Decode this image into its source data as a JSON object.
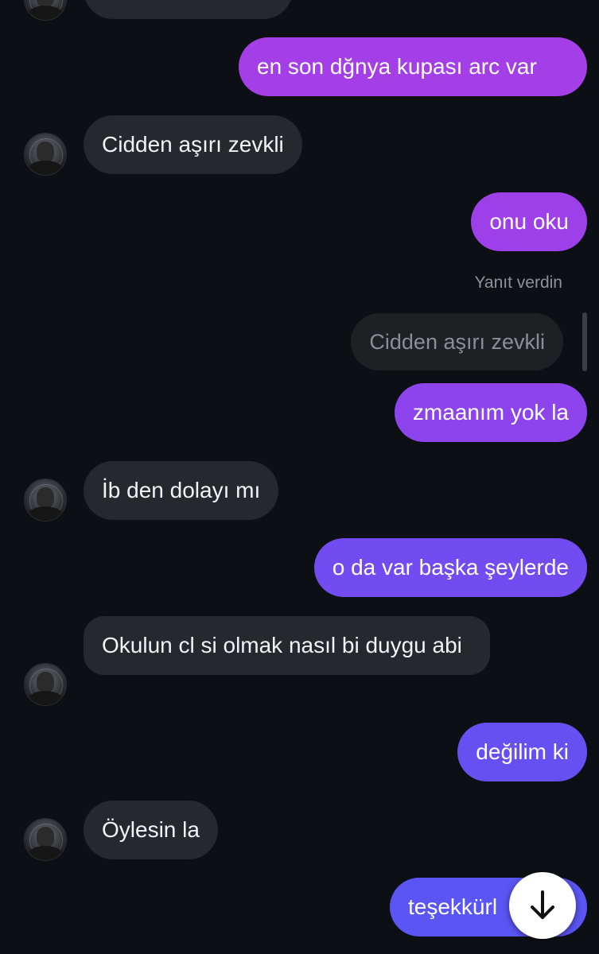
{
  "colors": {
    "background": "#0c1014",
    "incoming_bubble": "#25282d",
    "outgoing_gradient_top": "#a13fe8",
    "outgoing_gradient_bottom": "#5b55f2"
  },
  "messages": [
    {
      "dir": "in",
      "text": ""
    },
    {
      "dir": "out",
      "text": "en son dğnya kupası arc var"
    },
    {
      "dir": "in",
      "text": "Cidden aşırı zevkli"
    },
    {
      "dir": "out",
      "text": "onu oku"
    },
    {
      "dir": "out",
      "text": "zmaanım yok la"
    },
    {
      "dir": "in",
      "text": "İb den dolayı mı"
    },
    {
      "dir": "out",
      "text": "o da var başka şeylerde"
    },
    {
      "dir": "in",
      "text": "Okulun cl si olmak nasıl bi duygu abi"
    },
    {
      "dir": "out",
      "text": "değilim ki"
    },
    {
      "dir": "in",
      "text": "Öylesin la"
    },
    {
      "dir": "out",
      "text": "teşekkürl"
    }
  ],
  "reply": {
    "label": "Yanıt verdin",
    "quoted_text": "Cidden aşırı zevkli"
  },
  "scroll_down_button": {
    "icon": "arrow-down-icon"
  }
}
